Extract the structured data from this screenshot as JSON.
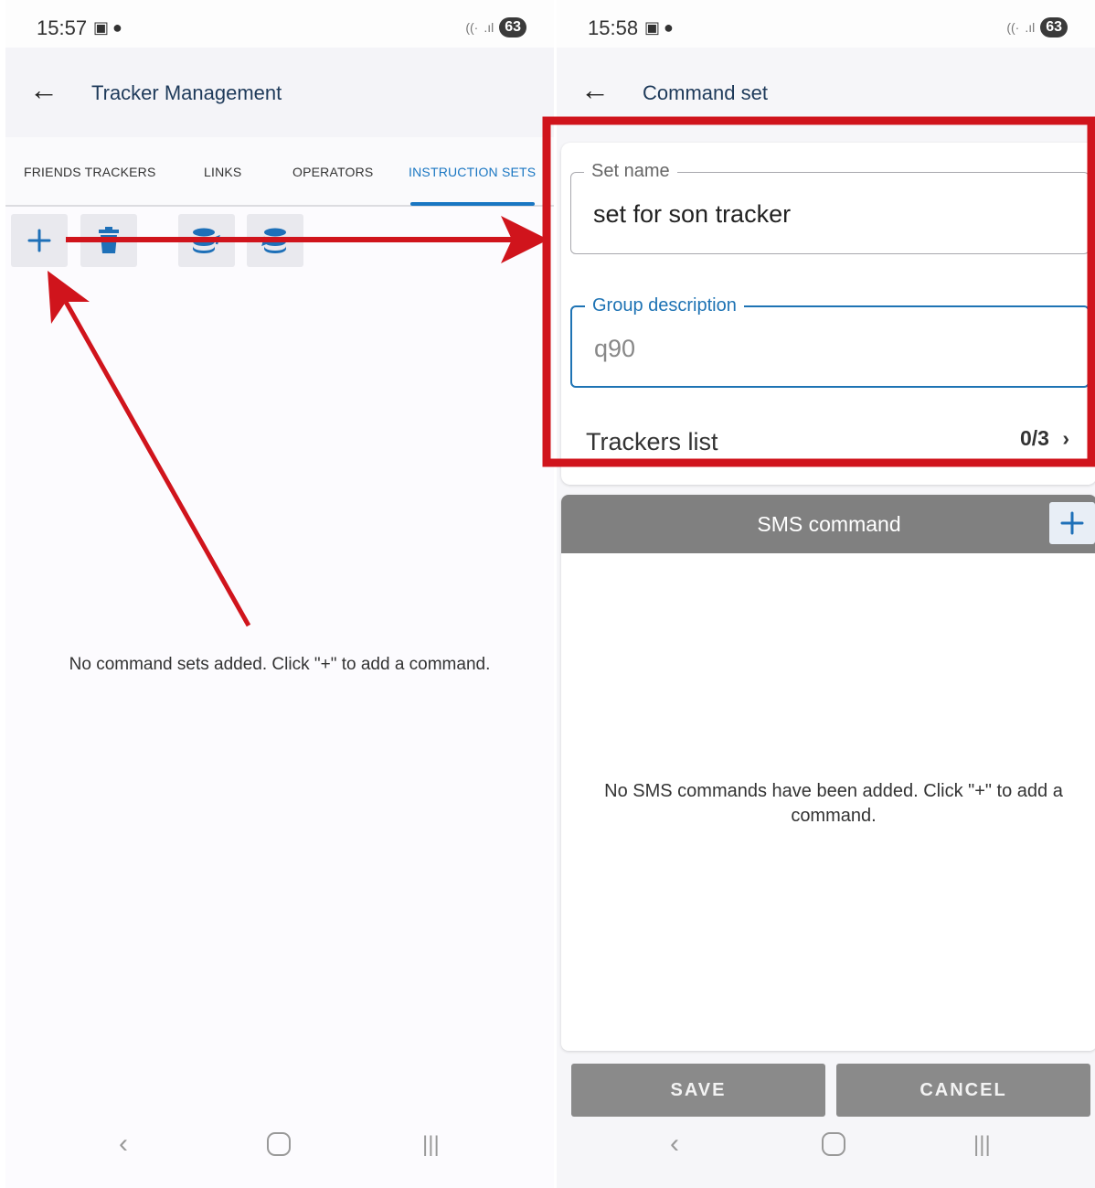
{
  "left": {
    "status": {
      "time": "15:57",
      "battery": "63"
    },
    "title": "Tracker Management",
    "tabs": [
      {
        "label": "FRIENDS TRACKERS"
      },
      {
        "label": "LINKS"
      },
      {
        "label": "OPERATORS"
      },
      {
        "label": "INSTRUCTION SETS",
        "active": true
      }
    ],
    "toolbar": [
      "add-icon",
      "trash-icon",
      "database-export-icon",
      "database-import-icon"
    ],
    "empty_text": "No command sets added. Click \"+\" to add a command."
  },
  "right": {
    "status": {
      "time": "15:58",
      "battery": "63"
    },
    "title": "Command set",
    "set_name": {
      "label": "Set name",
      "value": "set for son tracker"
    },
    "group_description": {
      "label": "Group description",
      "placeholder": "q90"
    },
    "trackers_list": {
      "label": "Trackers list",
      "count": "0/3"
    },
    "sms": {
      "title": "SMS command",
      "empty_text": "No SMS commands have been added. Click \"+\" to add a command."
    },
    "save_label": "SAVE",
    "cancel_label": "CANCEL"
  },
  "colors": {
    "accent": "#1976c2",
    "annotation": "#d0141c",
    "header_gray": "#808080"
  }
}
